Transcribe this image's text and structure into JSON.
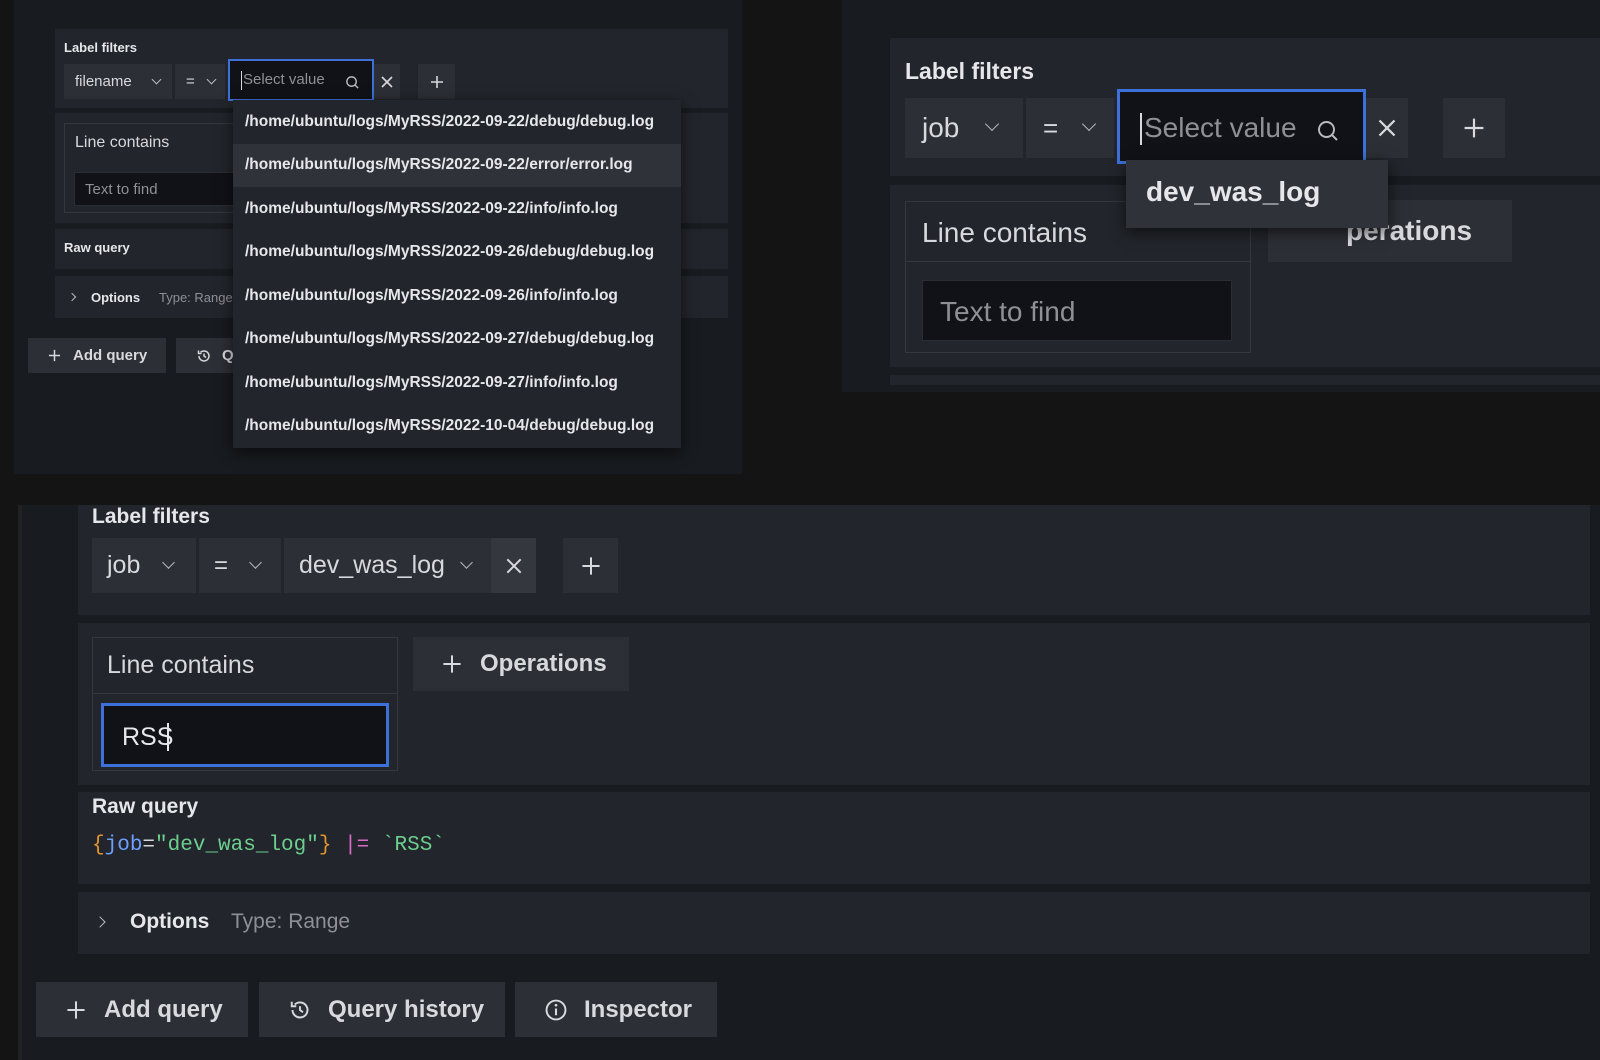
{
  "panel_small": {
    "label_filters": "Label filters",
    "label_key": "filename",
    "operator": "=",
    "value_placeholder": "Select value",
    "line_contains": "Line contains",
    "text_placeholder": "Text to find",
    "raw_query": "Raw query",
    "options": "Options",
    "type": "Type: Range",
    "add_query": "Add query",
    "query_history_partial": "Q",
    "dropdown_options": [
      "/home/ubuntu/logs/MyRSS/2022-09-22/debug/debug.log",
      "/home/ubuntu/logs/MyRSS/2022-09-22/error/error.log",
      "/home/ubuntu/logs/MyRSS/2022-09-22/info/info.log",
      "/home/ubuntu/logs/MyRSS/2022-09-26/debug/debug.log",
      "/home/ubuntu/logs/MyRSS/2022-09-26/info/info.log",
      "/home/ubuntu/logs/MyRSS/2022-09-27/debug/debug.log",
      "/home/ubuntu/logs/MyRSS/2022-09-27/info/info.log",
      "/home/ubuntu/logs/MyRSS/2022-10-04/debug/debug.log"
    ]
  },
  "panel_right": {
    "label_filters": "Label filters",
    "label_key": "job",
    "operator": "=",
    "value_placeholder": "Select value",
    "dropdown_option": "dev_was_log",
    "line_contains": "Line contains",
    "text_placeholder": "Text to find",
    "operations_partial": "perations"
  },
  "panel_main": {
    "label_filters": "Label filters",
    "label_key": "job",
    "operator": "=",
    "label_value": "dev_was_log",
    "line_contains": "Line contains",
    "line_value": "RSS",
    "operations": "Operations",
    "raw_query": "Raw query",
    "raw_query_parts": {
      "open_brace": "{",
      "key": "job",
      "eq": "=",
      "value": "\"dev_was_log\"",
      "close_brace": "}",
      "pipe": " |=",
      "text": " `RSS`"
    },
    "options": "Options",
    "type": "Type: Range",
    "add_query": "Add query",
    "query_history": "Query history",
    "inspector": "Inspector"
  },
  "colors": {
    "focus_border": "#3d71d9",
    "brace": "#e0952f",
    "key": "#6e9fff",
    "value": "#6ccf8e",
    "pipe": "#d96ac6"
  }
}
